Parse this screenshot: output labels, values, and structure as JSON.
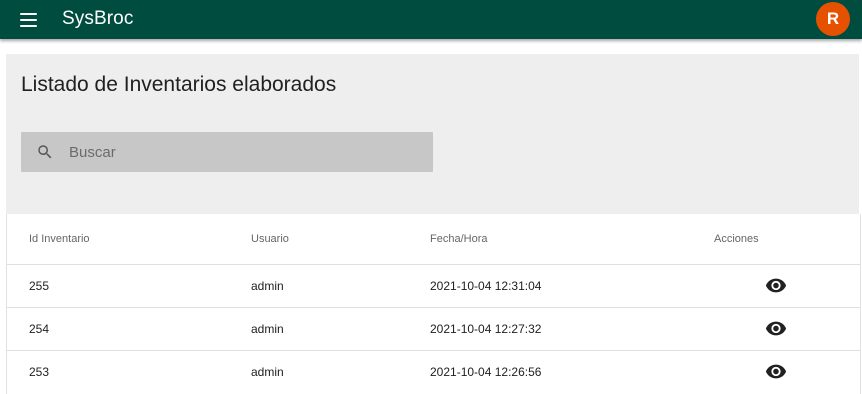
{
  "appbar": {
    "title": "SysBroc",
    "menu_icon": "menu-icon",
    "avatar_initial": "R",
    "background": "#004d40",
    "avatar_color": "#e65100"
  },
  "main": {
    "title": "Listado de Inventarios elaborados",
    "search": {
      "placeholder": "Buscar",
      "value": "",
      "icon": "search-icon"
    }
  },
  "table": {
    "headers": {
      "id": "Id Inventario",
      "user": "Usuario",
      "date": "Fecha/Hora",
      "actions": "Acciones"
    },
    "rows": [
      {
        "id": "255",
        "user": "admin",
        "date": "2021-10-04 12:31:04",
        "action_icon": "eye-icon"
      },
      {
        "id": "254",
        "user": "admin",
        "date": "2021-10-04 12:27:32",
        "action_icon": "eye-icon"
      },
      {
        "id": "253",
        "user": "admin",
        "date": "2021-10-04 12:26:56",
        "action_icon": "eye-icon"
      }
    ]
  }
}
